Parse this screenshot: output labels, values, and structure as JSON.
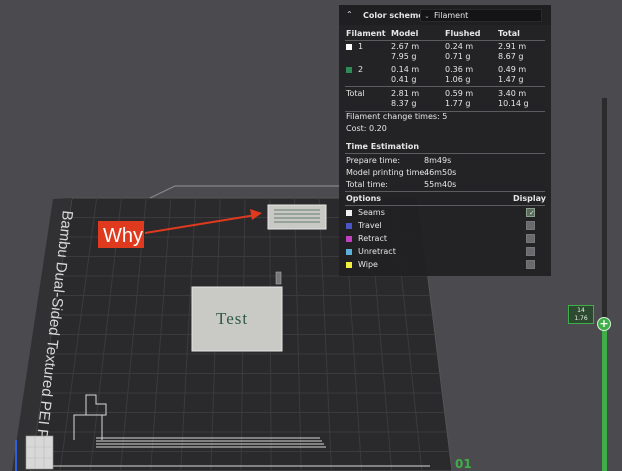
{
  "viewport": {
    "plate_label": "Bambu Dual-Sided Textured PEI Plate",
    "annotation_label": "Why",
    "object_label": "Test",
    "plate_number": "01"
  },
  "panel": {
    "header_icon": "chevron-up-icon",
    "header_label": "Color scheme",
    "color_scheme_value": "Filament",
    "table_headers": [
      "Filament",
      "Model",
      "Flushed",
      "Total"
    ],
    "filaments": [
      {
        "id": "1",
        "color": "#ffffff",
        "model_m": "2.67 m",
        "model_g": "7.95 g",
        "flushed_m": "0.24 m",
        "flushed_g": "0.71 g",
        "total_m": "2.91 m",
        "total_g": "8.67 g"
      },
      {
        "id": "2",
        "color": "#2e8b57",
        "model_m": "0.14 m",
        "model_g": "0.41 g",
        "flushed_m": "0.36 m",
        "flushed_g": "1.06 g",
        "total_m": "0.49 m",
        "total_g": "1.47 g"
      }
    ],
    "total_row": {
      "label": "Total",
      "model_m": "2.81 m",
      "model_g": "8.37 g",
      "flushed_m": "0.59 m",
      "flushed_g": "1.77 g",
      "total_m": "3.40 m",
      "total_g": "10.14 g"
    },
    "filament_change_times": "Filament change times:  5",
    "cost": "Cost:  0.20",
    "time_estimation": {
      "title": "Time Estimation",
      "rows": [
        {
          "label": "Prepare time:",
          "value": "8m49s"
        },
        {
          "label": "Model printing time:",
          "value": "46m50s"
        },
        {
          "label": "Total time:",
          "value": "55m40s"
        }
      ]
    },
    "options": {
      "header": "Options",
      "display_header": "Display",
      "items": [
        {
          "label": "Seams",
          "color": "#f0f0f0",
          "checked": true
        },
        {
          "label": "Travel",
          "color": "#4a55c8",
          "checked": false
        },
        {
          "label": "Retract",
          "color": "#c040c0",
          "checked": false
        },
        {
          "label": "Unretract",
          "color": "#5ab0d8",
          "checked": false
        },
        {
          "label": "Wipe",
          "color": "#f0f040",
          "checked": false
        }
      ]
    }
  },
  "layer_slider": {
    "layer": "14",
    "height": "1.76",
    "handle_glyph": "+"
  },
  "colors": {
    "accent_green": "#3fae49",
    "annotation_red": "#e03a1e"
  }
}
